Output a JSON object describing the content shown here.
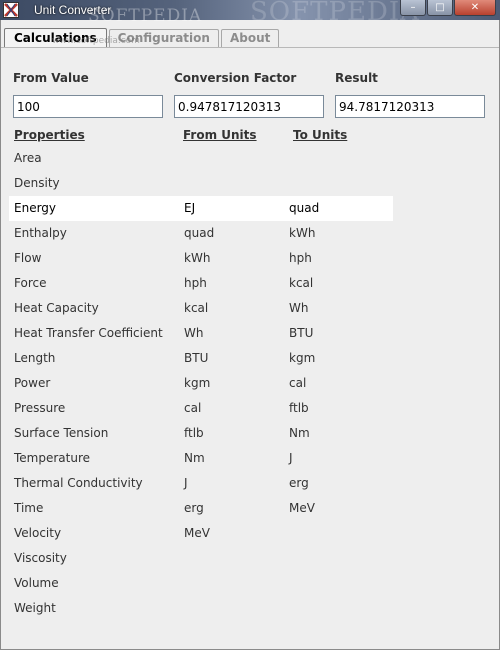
{
  "window": {
    "title": "Unit Converter",
    "watermark": "SOFTPEDIA",
    "watermark_small": "www.softpedia.com",
    "minimize_glyph": "–",
    "maximize_glyph": "□",
    "close_glyph": "✕"
  },
  "tabs": [
    {
      "label": "Calculations",
      "active": true
    },
    {
      "label": "Configuration",
      "active": false
    },
    {
      "label": "About",
      "active": false
    }
  ],
  "fields": {
    "from_value": {
      "label": "From Value",
      "value": "100"
    },
    "conversion_factor": {
      "label": "Conversion Factor",
      "value": "0.947817120313"
    },
    "result": {
      "label": "Result",
      "value": "94.7817120313"
    }
  },
  "table": {
    "headers": {
      "properties": "Properties",
      "from_units": "From Units",
      "to_units": "To Units"
    },
    "rows": [
      {
        "property": "Area",
        "from": "",
        "to": ""
      },
      {
        "property": "Density",
        "from": "",
        "to": ""
      },
      {
        "property": "Energy",
        "from": "EJ",
        "to": "quad"
      },
      {
        "property": "Enthalpy",
        "from": "quad",
        "to": "kWh"
      },
      {
        "property": "Flow",
        "from": "kWh",
        "to": "hph"
      },
      {
        "property": "Force",
        "from": "hph",
        "to": "kcal"
      },
      {
        "property": "Heat Capacity",
        "from": "kcal",
        "to": "Wh"
      },
      {
        "property": "Heat Transfer Coefficient",
        "from": "Wh",
        "to": "BTU"
      },
      {
        "property": "Length",
        "from": "BTU",
        "to": "kgm"
      },
      {
        "property": "Power",
        "from": "kgm",
        "to": "cal"
      },
      {
        "property": "Pressure",
        "from": "cal",
        "to": "ftlb"
      },
      {
        "property": "Surface Tension",
        "from": "ftlb",
        "to": "Nm"
      },
      {
        "property": "Temperature",
        "from": "Nm",
        "to": "J"
      },
      {
        "property": "Thermal Conductivity",
        "from": "J",
        "to": "erg"
      },
      {
        "property": "Time",
        "from": "erg",
        "to": "MeV"
      },
      {
        "property": "Velocity",
        "from": "MeV",
        "to": ""
      },
      {
        "property": "Viscosity",
        "from": "",
        "to": ""
      },
      {
        "property": "Volume",
        "from": "",
        "to": ""
      },
      {
        "property": "Weight",
        "from": "",
        "to": ""
      }
    ],
    "selected_property": "Energy"
  }
}
